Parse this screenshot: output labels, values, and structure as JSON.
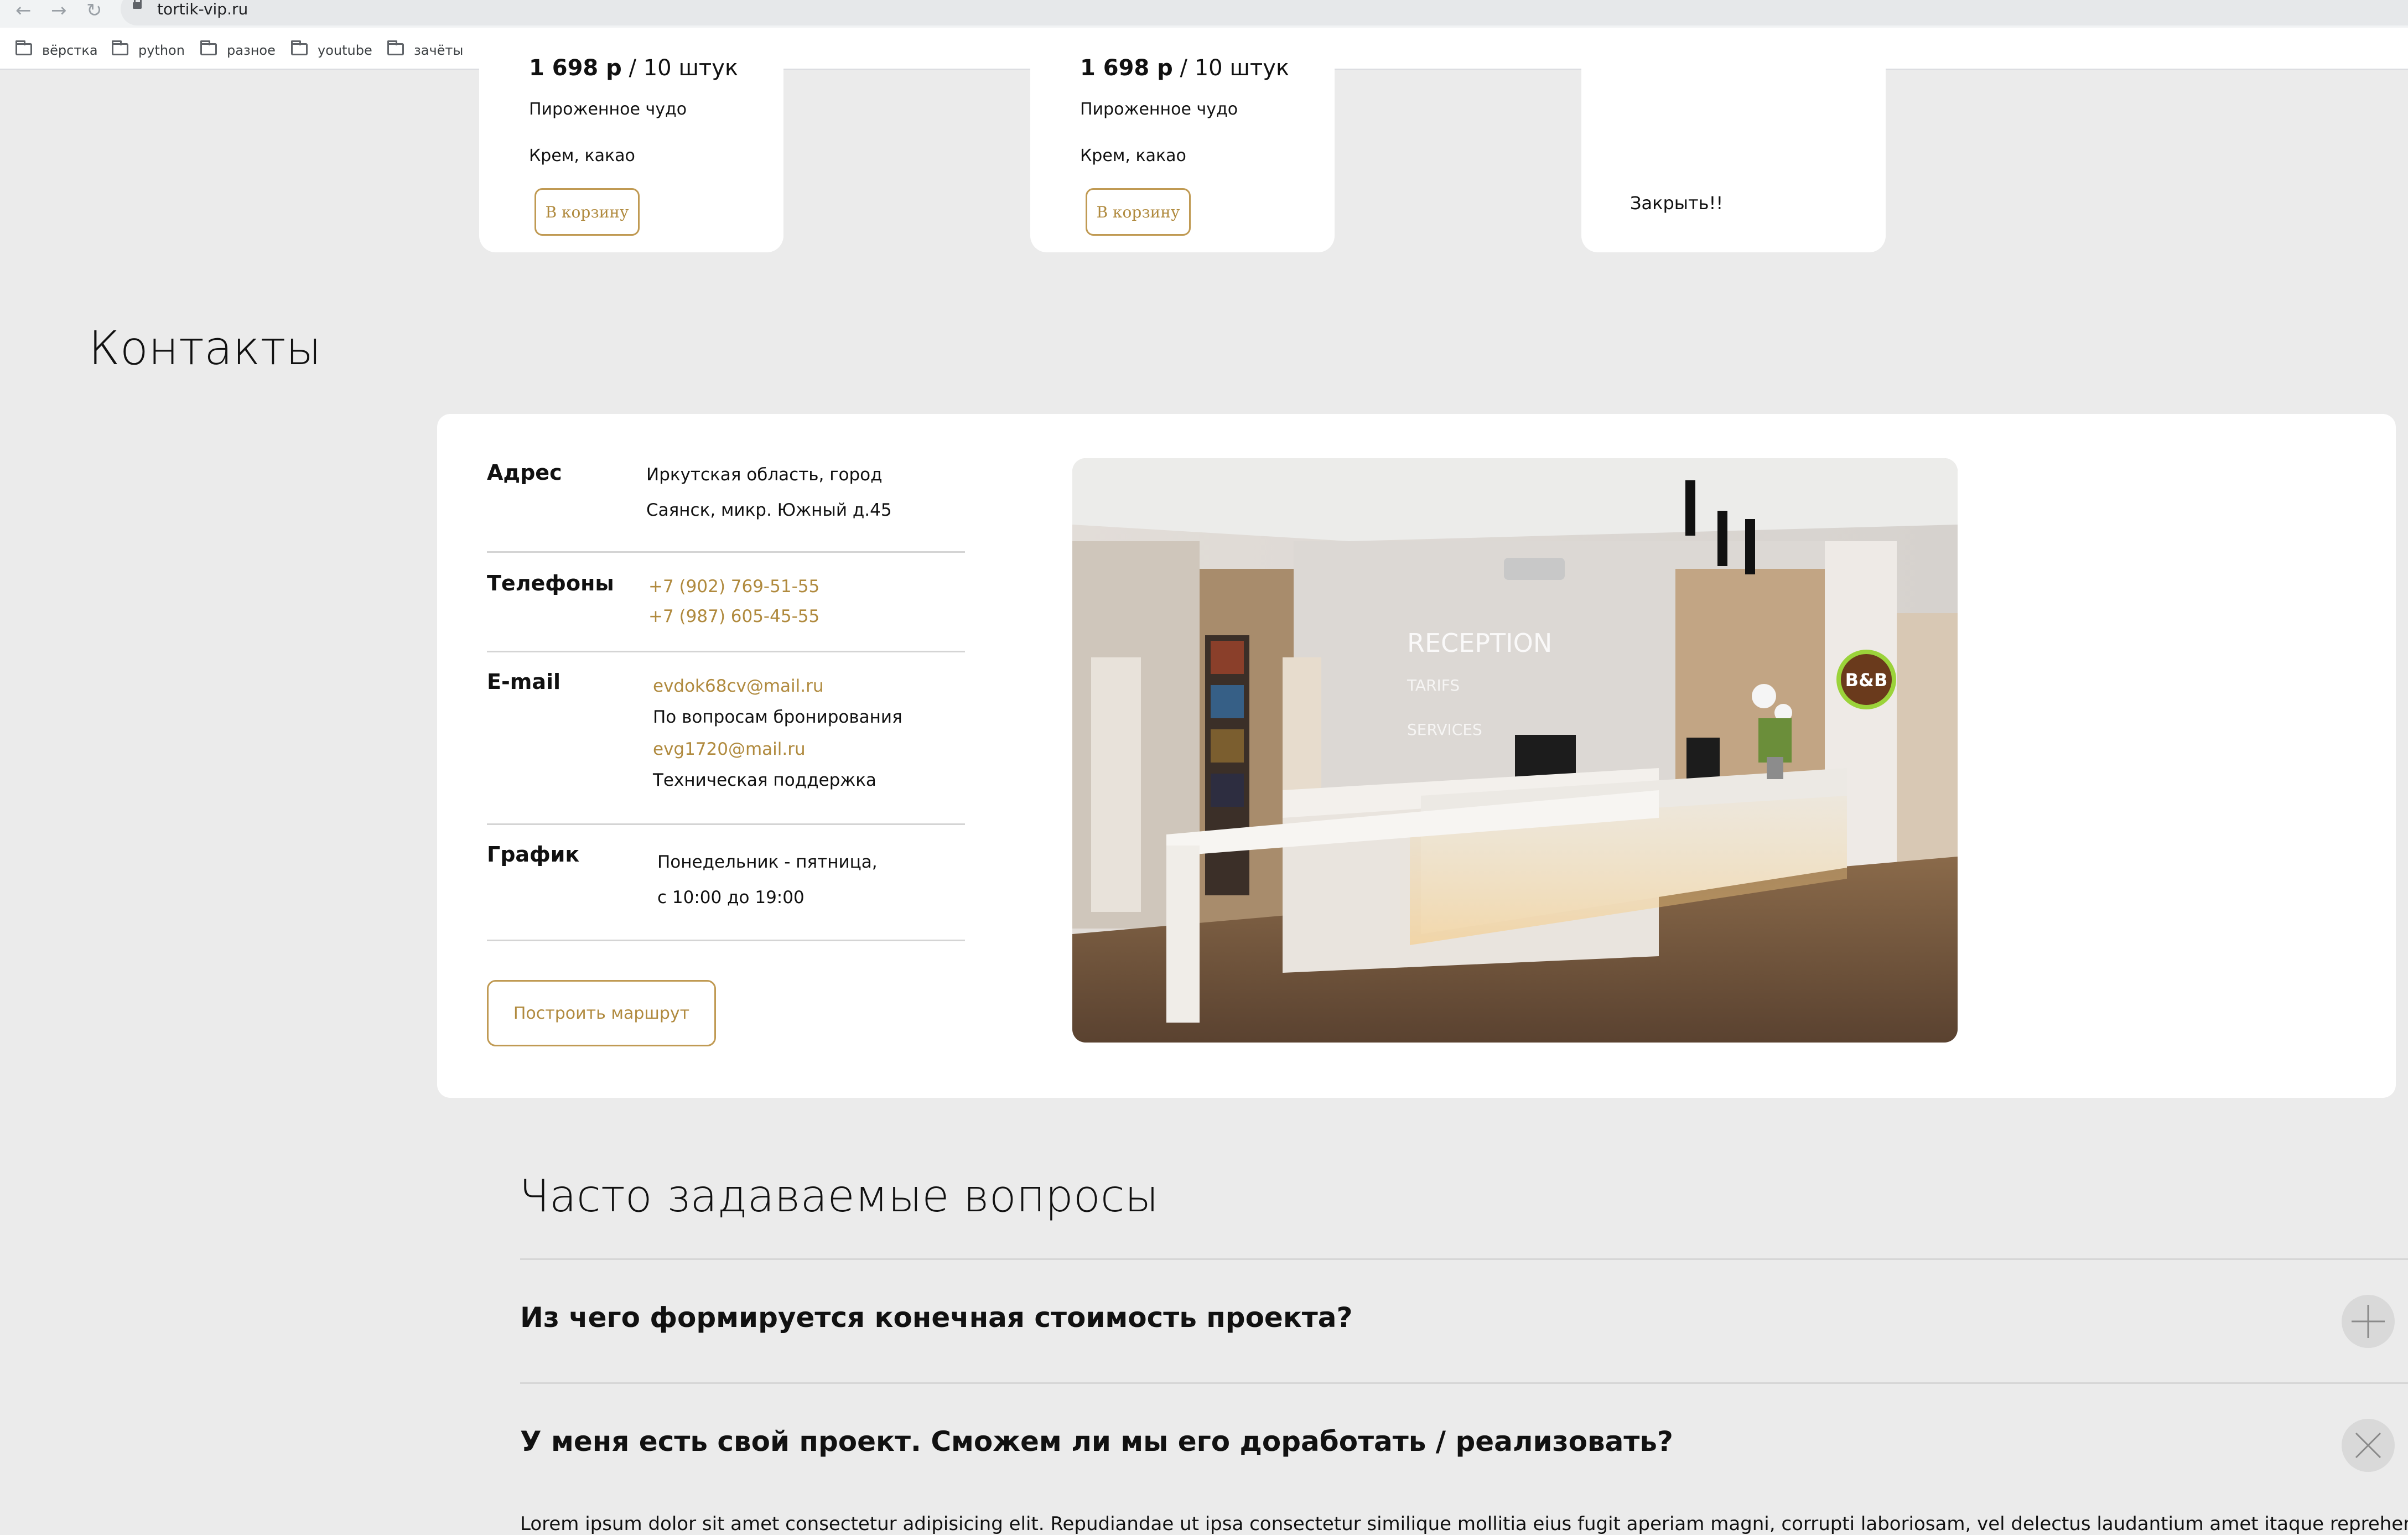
{
  "browser": {
    "url": "tortik-vip.ru",
    "bookmarks": [
      "вёрстка",
      "python",
      "разное",
      "youtube",
      "зачёты"
    ]
  },
  "products": [
    {
      "price": "1 698 р",
      "unit": " / 10 штук",
      "name": "Пироженное чудо",
      "desc": "Крем, какао",
      "button": "В корзину"
    },
    {
      "price": "1 698 р",
      "unit": " / 10 штук",
      "name": "Пироженное чудо",
      "desc": "Крем, какао",
      "button": "В корзину"
    }
  ],
  "close_label": "Закрыть!!",
  "contacts": {
    "title": "Контакты",
    "address_label": "Адрес",
    "address_line1": "Иркутская область, город",
    "address_line2": "Саянск, микр. Южный д.45",
    "phones_label": "Телефоны",
    "phone1": "+7 (902) 769-51-55",
    "phone2": "+7 (987) 605-45-55",
    "email_label": "E-mail",
    "email1": "evdok68cv@mail.ru",
    "email1_note": "По вопросам бронирования",
    "email2": "evg1720@mail.ru",
    "email2_note": "Техническая поддержка",
    "schedule_label": "График",
    "schedule_line1": "Понедельник - пятница,",
    "schedule_line2": "с 10:00 до 19:00",
    "route_button": "Построить маршрут",
    "photo_reception": "RECEPTION",
    "photo_tarifs": "TARIFS",
    "photo_services": "SERVICES",
    "photo_logo": "B&B"
  },
  "faq": {
    "title": "Часто задаваемые вопросы",
    "q1": "Из чего формируется конечная стоимость проекта?",
    "q2": "У меня есть свой проект. Сможем ли мы его доработать / реализовать?",
    "answer": "Lorem ipsum dolor sit amet consectetur adipisicing elit. Repudiandae ut ipsa consectetur similique mollitia eius fugit aperiam magni, corrupti laboriosam, vel delectus laudantium amet itaque reprehenderit et"
  }
}
